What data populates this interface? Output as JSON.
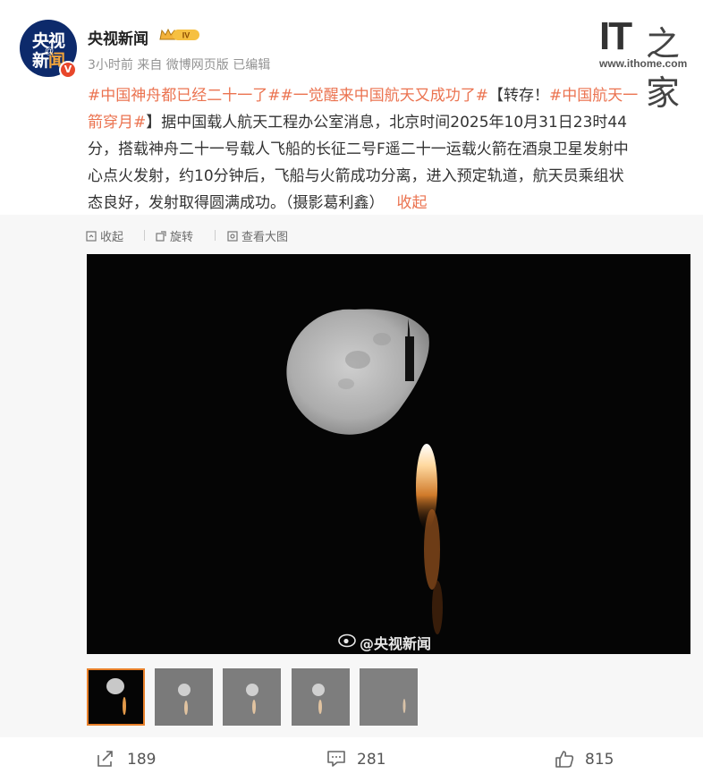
{
  "account": {
    "avatar_text_line1": "央视",
    "avatar_text_line2_a": "新",
    "avatar_text_line2_b": "闻",
    "avatar_at": "@",
    "verified_badge": "V",
    "username": "央视新闻",
    "vip_badge": "IV",
    "meta": "3小时前 来自 微博网页版 已编辑"
  },
  "brand": {
    "it": "IT",
    "name_cn": "之家",
    "url": "www.ithome.com"
  },
  "post": {
    "line1_tag_a": "#中国神舟都已经二十一了#",
    "line1_tag_b": "#一觉醒来中国航天又成功了#",
    "line1_text": "【转存！",
    "line1_tag_c": "#中国航天一",
    "line2_tag_c": "箭穿月#",
    "line2_text": "】据中国载人航天工程办公室消息，北京时间2025年10月31日23时44",
    "line3": "分，搭载神舟二十一号载人飞船的长征二号F遥二十一运载火箭在酒泉卫星发射中",
    "line4": "心点火发射，约10分钟后，飞船与火箭成功分离，进入预定轨道，航天员乘组状",
    "line5": "态良好，发射取得圆满成功。（摄影葛利鑫）",
    "collapse_link": "收起"
  },
  "media_toolbar": {
    "collapse": "收起",
    "rotate": "旋转",
    "view_large": "查看大图"
  },
  "photo": {
    "watermark": "@央视新闻",
    "selected_index": 0,
    "thumbnail_count": 5
  },
  "footer": {
    "repost_count": "189",
    "comment_count": "281",
    "like_count": "815"
  },
  "colors": {
    "accent_link": "#eb7350",
    "thumb_selected_border": "#e8802a",
    "avatar_bg": "#0d2a6b"
  }
}
